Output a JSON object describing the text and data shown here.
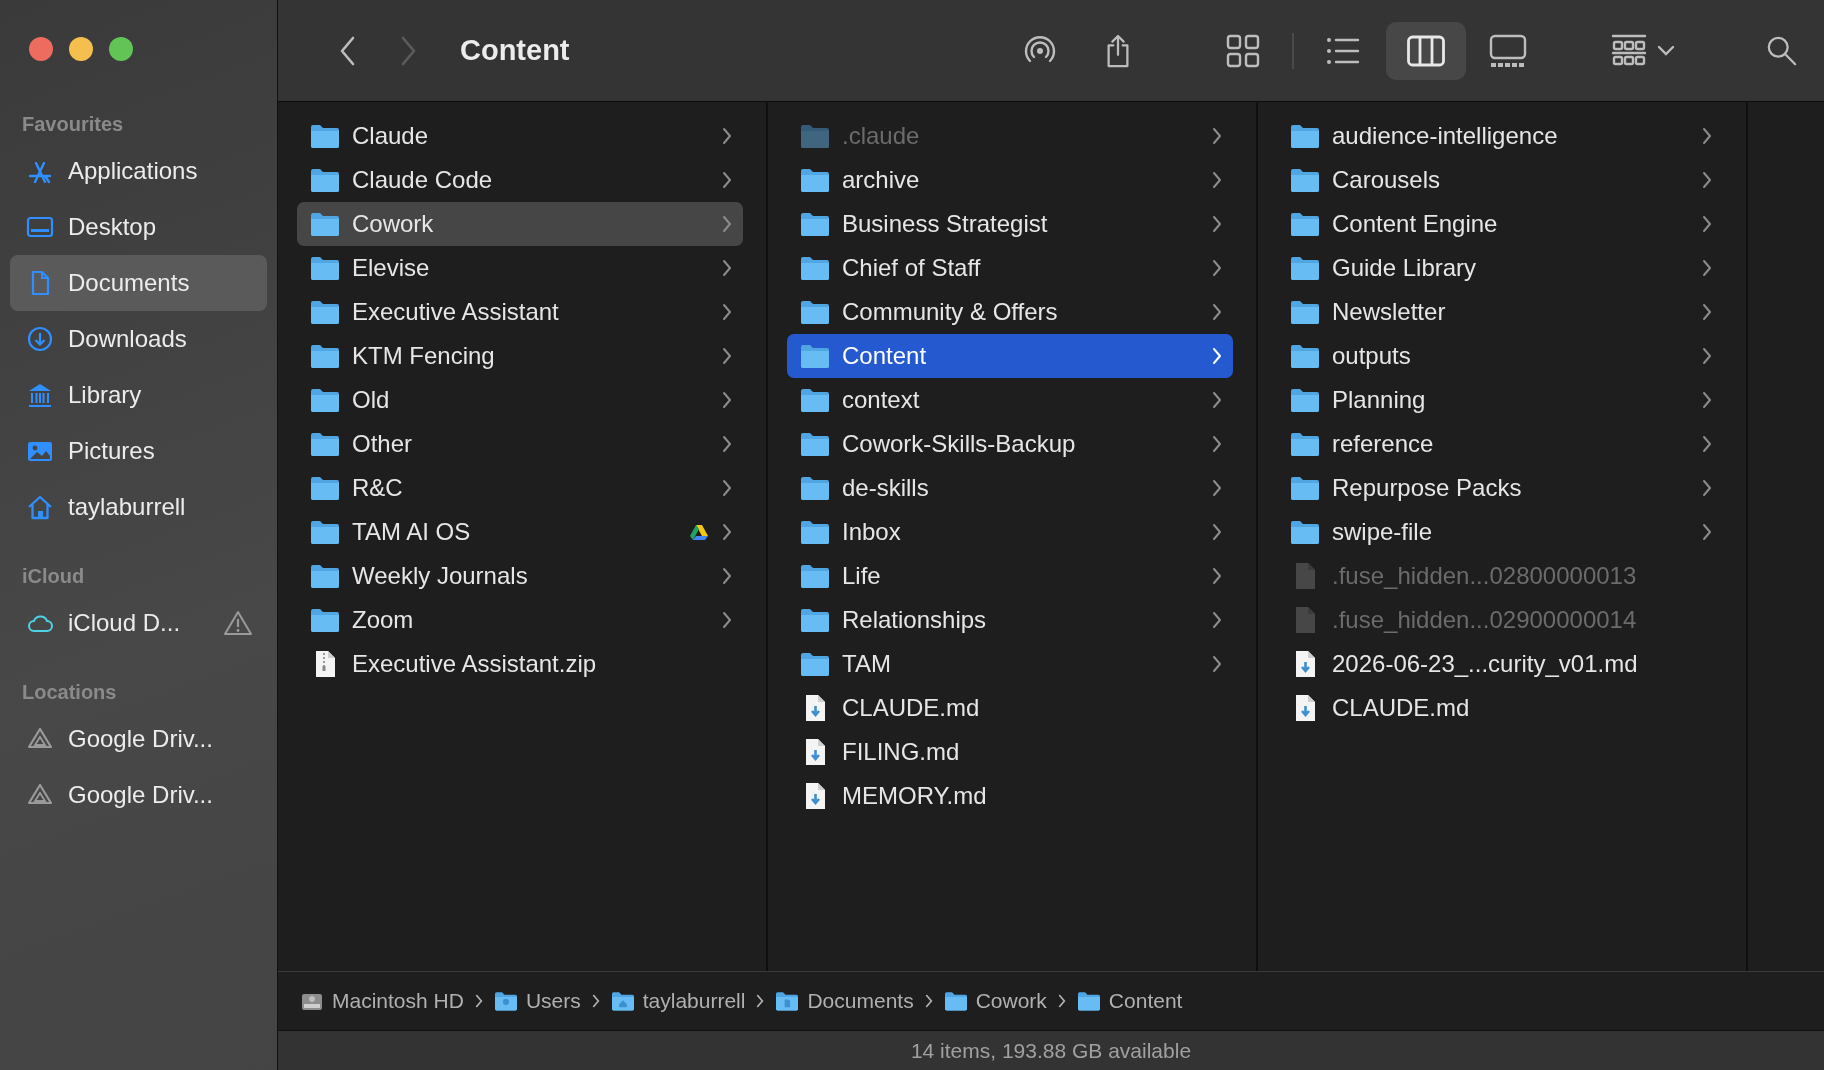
{
  "window": {
    "title": "Content"
  },
  "toolbar": {
    "back": {
      "disabled": false
    },
    "forward": {
      "disabled": true
    },
    "view_modes": [
      {
        "kind": "icons",
        "selected": false
      },
      {
        "kind": "list",
        "selected": false
      },
      {
        "kind": "columns",
        "selected": true
      },
      {
        "kind": "gallery",
        "selected": false
      }
    ]
  },
  "sidebar": {
    "sections": [
      {
        "title": "Favourites",
        "items": [
          {
            "label": "Applications",
            "kind": "applications",
            "selected": false,
            "warning": false
          },
          {
            "label": "Desktop",
            "kind": "desktop",
            "selected": false,
            "warning": false
          },
          {
            "label": "Documents",
            "kind": "documents",
            "selected": true,
            "warning": false
          },
          {
            "label": "Downloads",
            "kind": "downloads",
            "selected": false,
            "warning": false
          },
          {
            "label": "Library",
            "kind": "library",
            "selected": false,
            "warning": false
          },
          {
            "label": "Pictures",
            "kind": "pictures",
            "selected": false,
            "warning": false
          },
          {
            "label": "taylaburrell",
            "kind": "home",
            "selected": false,
            "warning": false
          }
        ]
      },
      {
        "title": "iCloud",
        "items": [
          {
            "label": "iCloud D...",
            "kind": "cloud",
            "selected": false,
            "warning": true
          }
        ]
      },
      {
        "title": "Locations",
        "items": [
          {
            "label": "Google Driv...",
            "kind": "drive",
            "selected": false,
            "warning": false
          },
          {
            "label": "Google Driv...",
            "kind": "drive",
            "selected": false,
            "warning": false
          }
        ]
      }
    ]
  },
  "columns": [
    {
      "active": false,
      "items": [
        {
          "name": "Claude",
          "kind": "folder",
          "hidden": false,
          "selected": false,
          "shared": false
        },
        {
          "name": "Claude Code",
          "kind": "folder",
          "hidden": false,
          "selected": false,
          "shared": false
        },
        {
          "name": "Cowork",
          "kind": "folder",
          "hidden": false,
          "selected": true,
          "shared": false
        },
        {
          "name": "Elevise",
          "kind": "folder",
          "hidden": false,
          "selected": false,
          "shared": false
        },
        {
          "name": "Executive Assistant",
          "kind": "folder",
          "hidden": false,
          "selected": false,
          "shared": false
        },
        {
          "name": "KTM Fencing",
          "kind": "folder",
          "hidden": false,
          "selected": false,
          "shared": false
        },
        {
          "name": "Old",
          "kind": "folder",
          "hidden": false,
          "selected": false,
          "shared": false
        },
        {
          "name": "Other",
          "kind": "folder",
          "hidden": false,
          "selected": false,
          "shared": false
        },
        {
          "name": "R&C",
          "kind": "folder",
          "hidden": false,
          "selected": false,
          "shared": false
        },
        {
          "name": "TAM AI OS",
          "kind": "folder",
          "hidden": false,
          "selected": false,
          "shared": true
        },
        {
          "name": "Weekly Journals",
          "kind": "folder",
          "hidden": false,
          "selected": false,
          "shared": false
        },
        {
          "name": "Zoom",
          "kind": "folder",
          "hidden": false,
          "selected": false,
          "shared": false
        },
        {
          "name": "Executive Assistant.zip",
          "kind": "zip",
          "hidden": false,
          "selected": false,
          "shared": false
        }
      ]
    },
    {
      "active": true,
      "items": [
        {
          "name": ".claude",
          "kind": "folder",
          "hidden": true,
          "selected": false,
          "shared": false
        },
        {
          "name": "archive",
          "kind": "folder",
          "hidden": false,
          "selected": false,
          "shared": false
        },
        {
          "name": "Business Strategist",
          "kind": "folder",
          "hidden": false,
          "selected": false,
          "shared": false
        },
        {
          "name": "Chief of Staff",
          "kind": "folder",
          "hidden": false,
          "selected": false,
          "shared": false
        },
        {
          "name": "Community & Offers",
          "kind": "folder",
          "hidden": false,
          "selected": false,
          "shared": false
        },
        {
          "name": "Content",
          "kind": "folder",
          "hidden": false,
          "selected": true,
          "shared": false
        },
        {
          "name": "context",
          "kind": "folder",
          "hidden": false,
          "selected": false,
          "shared": false
        },
        {
          "name": "Cowork-Skills-Backup",
          "kind": "folder",
          "hidden": false,
          "selected": false,
          "shared": false
        },
        {
          "name": "de-skills",
          "kind": "folder",
          "hidden": false,
          "selected": false,
          "shared": false
        },
        {
          "name": "Inbox",
          "kind": "folder",
          "hidden": false,
          "selected": false,
          "shared": false
        },
        {
          "name": "Life",
          "kind": "folder",
          "hidden": false,
          "selected": false,
          "shared": false
        },
        {
          "name": "Relationships",
          "kind": "folder",
          "hidden": false,
          "selected": false,
          "shared": false
        },
        {
          "name": "TAM",
          "kind": "folder",
          "hidden": false,
          "selected": false,
          "shared": false
        },
        {
          "name": "CLAUDE.md",
          "kind": "markdown",
          "hidden": false,
          "selected": false,
          "shared": false
        },
        {
          "name": "FILING.md",
          "kind": "markdown",
          "hidden": false,
          "selected": false,
          "shared": false
        },
        {
          "name": "MEMORY.md",
          "kind": "markdown",
          "hidden": false,
          "selected": false,
          "shared": false
        }
      ]
    },
    {
      "items": [
        {
          "name": "audience-intelligence",
          "kind": "folder",
          "hidden": false,
          "selected": false,
          "shared": false
        },
        {
          "name": "Carousels",
          "kind": "folder",
          "hidden": false,
          "selected": false,
          "shared": false
        },
        {
          "name": "Content Engine",
          "kind": "folder",
          "hidden": false,
          "selected": false,
          "shared": false
        },
        {
          "name": "Guide Library",
          "kind": "folder",
          "hidden": false,
          "selected": false,
          "shared": false
        },
        {
          "name": "Newsletter",
          "kind": "folder",
          "hidden": false,
          "selected": false,
          "shared": false
        },
        {
          "name": "outputs",
          "kind": "folder",
          "hidden": false,
          "selected": false,
          "shared": false
        },
        {
          "name": "Planning",
          "kind": "folder",
          "hidden": false,
          "selected": false,
          "shared": false
        },
        {
          "name": "reference",
          "kind": "folder",
          "hidden": false,
          "selected": false,
          "shared": false
        },
        {
          "name": "Repurpose Packs",
          "kind": "folder",
          "hidden": false,
          "selected": false,
          "shared": false
        },
        {
          "name": "swipe-file",
          "kind": "folder",
          "hidden": false,
          "selected": false,
          "shared": false
        },
        {
          "name": ".fuse_hidden...02800000013",
          "kind": "blank",
          "hidden": true,
          "selected": false,
          "shared": false
        },
        {
          "name": ".fuse_hidden...02900000014",
          "kind": "blank",
          "hidden": true,
          "selected": false,
          "shared": false
        },
        {
          "name": "2026-06-23_...curity_v01.md",
          "kind": "markdown",
          "hidden": false,
          "selected": false,
          "shared": false
        },
        {
          "name": "CLAUDE.md",
          "kind": "markdown",
          "hidden": false,
          "selected": false,
          "shared": false
        }
      ]
    }
  ],
  "path_bar": [
    {
      "label": "Macintosh HD",
      "kind": "disk"
    },
    {
      "label": "Users",
      "kind": "users"
    },
    {
      "label": "taylaburrell",
      "kind": "home"
    },
    {
      "label": "Documents",
      "kind": "documents"
    },
    {
      "label": "Cowork",
      "kind": "folder"
    },
    {
      "label": "Content",
      "kind": "folder"
    }
  ],
  "status_bar": "14 items, 193.88 GB available"
}
